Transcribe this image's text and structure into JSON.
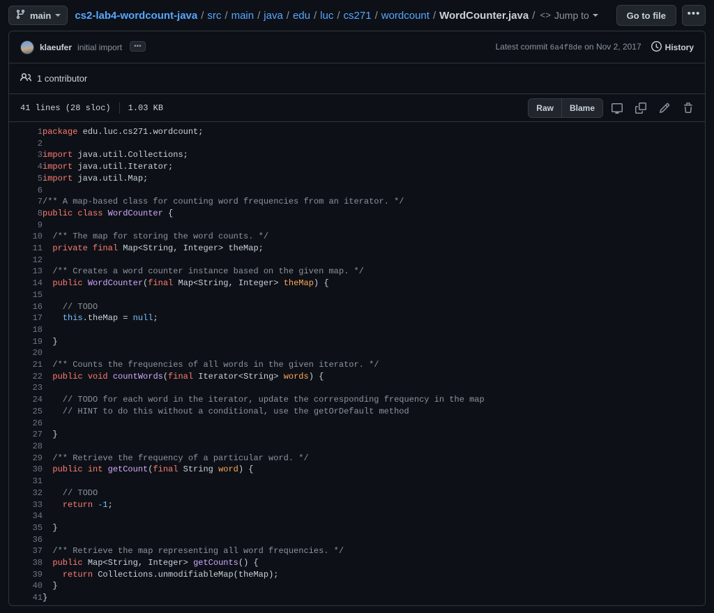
{
  "topbar": {
    "branch": {
      "label": "main",
      "icon": "git-branch-icon"
    },
    "breadcrumb": {
      "repo": "cs2-lab4-wordcount-java",
      "path": [
        "src",
        "main",
        "java",
        "edu",
        "luc",
        "cs271",
        "wordcount"
      ],
      "file": "WordCounter.java",
      "separator": "/"
    },
    "jump_to": {
      "label": "Jump to",
      "glyph": "<>"
    },
    "go_to_file": "Go to file",
    "kebab": "•••"
  },
  "commit": {
    "author": "klaeufer",
    "message": "initial import",
    "expand_label": "•••",
    "latest_commit_prefix": "Latest commit",
    "sha": "6a4f8de",
    "date_prefix": "on",
    "date": "Nov 2, 2017",
    "history_label": "History"
  },
  "contributors": {
    "count_label": "1 contributor",
    "icon": "people-icon"
  },
  "file_toolbar": {
    "lines": "41 lines (28 sloc)",
    "size": "1.03 KB",
    "raw": "Raw",
    "blame": "Blame",
    "icons": [
      "desktop-icon",
      "copy-icon",
      "pencil-icon",
      "trash-icon"
    ]
  },
  "code": {
    "lines": [
      {
        "n": 1,
        "tokens": [
          {
            "t": "package",
            "c": "k"
          },
          {
            "t": " edu.luc.cs271.wordcount;",
            "c": ""
          }
        ]
      },
      {
        "n": 2,
        "tokens": []
      },
      {
        "n": 3,
        "tokens": [
          {
            "t": "import",
            "c": "k"
          },
          {
            "t": " java.util.Collections;",
            "c": ""
          }
        ]
      },
      {
        "n": 4,
        "tokens": [
          {
            "t": "import",
            "c": "k"
          },
          {
            "t": " java.util.Iterator;",
            "c": ""
          }
        ]
      },
      {
        "n": 5,
        "tokens": [
          {
            "t": "import",
            "c": "k"
          },
          {
            "t": " java.util.Map;",
            "c": ""
          }
        ]
      },
      {
        "n": 6,
        "tokens": []
      },
      {
        "n": 7,
        "tokens": [
          {
            "t": "/** A map-based class for counting word frequencies from an iterator. */",
            "c": "c"
          }
        ]
      },
      {
        "n": 8,
        "tokens": [
          {
            "t": "public class",
            "c": "k"
          },
          {
            "t": " ",
            "c": ""
          },
          {
            "t": "WordCounter",
            "c": "f"
          },
          {
            "t": " {",
            "c": ""
          }
        ]
      },
      {
        "n": 9,
        "tokens": []
      },
      {
        "n": 10,
        "tokens": [
          {
            "t": "  /** The map for storing the word counts. */",
            "c": "c"
          }
        ]
      },
      {
        "n": 11,
        "tokens": [
          {
            "t": "  ",
            "c": ""
          },
          {
            "t": "private final",
            "c": "k"
          },
          {
            "t": " Map<String, Integer> theMap;",
            "c": ""
          }
        ]
      },
      {
        "n": 12,
        "tokens": []
      },
      {
        "n": 13,
        "tokens": [
          {
            "t": "  /** Creates a word counter instance based on the given map. */",
            "c": "c"
          }
        ]
      },
      {
        "n": 14,
        "tokens": [
          {
            "t": "  ",
            "c": ""
          },
          {
            "t": "public",
            "c": "k"
          },
          {
            "t": " ",
            "c": ""
          },
          {
            "t": "WordCounter",
            "c": "f"
          },
          {
            "t": "(",
            "c": ""
          },
          {
            "t": "final",
            "c": "k"
          },
          {
            "t": " Map<String, Integer> ",
            "c": ""
          },
          {
            "t": "theMap",
            "c": "p"
          },
          {
            "t": ") {",
            "c": ""
          }
        ]
      },
      {
        "n": 15,
        "tokens": []
      },
      {
        "n": 16,
        "tokens": [
          {
            "t": "    // TODO",
            "c": "c"
          }
        ]
      },
      {
        "n": 17,
        "tokens": [
          {
            "t": "    ",
            "c": ""
          },
          {
            "t": "this",
            "c": "n"
          },
          {
            "t": ".theMap = ",
            "c": ""
          },
          {
            "t": "null",
            "c": "n"
          },
          {
            "t": ";",
            "c": ""
          }
        ]
      },
      {
        "n": 18,
        "tokens": []
      },
      {
        "n": 19,
        "tokens": [
          {
            "t": "  }",
            "c": ""
          }
        ]
      },
      {
        "n": 20,
        "tokens": []
      },
      {
        "n": 21,
        "tokens": [
          {
            "t": "  /** Counts the frequencies of all words in the given iterator. */",
            "c": "c"
          }
        ]
      },
      {
        "n": 22,
        "tokens": [
          {
            "t": "  ",
            "c": ""
          },
          {
            "t": "public void",
            "c": "k"
          },
          {
            "t": " ",
            "c": ""
          },
          {
            "t": "countWords",
            "c": "f"
          },
          {
            "t": "(",
            "c": ""
          },
          {
            "t": "final",
            "c": "k"
          },
          {
            "t": " Iterator<String> ",
            "c": ""
          },
          {
            "t": "words",
            "c": "p"
          },
          {
            "t": ") {",
            "c": ""
          }
        ]
      },
      {
        "n": 23,
        "tokens": []
      },
      {
        "n": 24,
        "tokens": [
          {
            "t": "    // TODO for each word in the iterator, update the corresponding frequency in the map",
            "c": "c"
          }
        ]
      },
      {
        "n": 25,
        "tokens": [
          {
            "t": "    // HINT to do this without a conditional, use the getOrDefault method",
            "c": "c"
          }
        ]
      },
      {
        "n": 26,
        "tokens": []
      },
      {
        "n": 27,
        "tokens": [
          {
            "t": "  }",
            "c": ""
          }
        ]
      },
      {
        "n": 28,
        "tokens": []
      },
      {
        "n": 29,
        "tokens": [
          {
            "t": "  /** Retrieve the frequency of a particular word. */",
            "c": "c"
          }
        ]
      },
      {
        "n": 30,
        "tokens": [
          {
            "t": "  ",
            "c": ""
          },
          {
            "t": "public int",
            "c": "k"
          },
          {
            "t": " ",
            "c": ""
          },
          {
            "t": "getCount",
            "c": "f"
          },
          {
            "t": "(",
            "c": ""
          },
          {
            "t": "final",
            "c": "k"
          },
          {
            "t": " String ",
            "c": ""
          },
          {
            "t": "word",
            "c": "p"
          },
          {
            "t": ") {",
            "c": ""
          }
        ]
      },
      {
        "n": 31,
        "tokens": []
      },
      {
        "n": 32,
        "tokens": [
          {
            "t": "    // TODO",
            "c": "c"
          }
        ]
      },
      {
        "n": 33,
        "tokens": [
          {
            "t": "    ",
            "c": ""
          },
          {
            "t": "return",
            "c": "k"
          },
          {
            "t": " ",
            "c": ""
          },
          {
            "t": "-1",
            "c": "n"
          },
          {
            "t": ";",
            "c": ""
          }
        ]
      },
      {
        "n": 34,
        "tokens": []
      },
      {
        "n": 35,
        "tokens": [
          {
            "t": "  }",
            "c": ""
          }
        ]
      },
      {
        "n": 36,
        "tokens": []
      },
      {
        "n": 37,
        "tokens": [
          {
            "t": "  /** Retrieve the map representing all word frequencies. */",
            "c": "c"
          }
        ]
      },
      {
        "n": 38,
        "tokens": [
          {
            "t": "  ",
            "c": ""
          },
          {
            "t": "public",
            "c": "k"
          },
          {
            "t": " Map<String, Integer> ",
            "c": ""
          },
          {
            "t": "getCounts",
            "c": "f"
          },
          {
            "t": "() {",
            "c": ""
          }
        ]
      },
      {
        "n": 39,
        "tokens": [
          {
            "t": "    ",
            "c": ""
          },
          {
            "t": "return",
            "c": "k"
          },
          {
            "t": " Collections.unmodifiableMap(theMap);",
            "c": ""
          }
        ]
      },
      {
        "n": 40,
        "tokens": [
          {
            "t": "  }",
            "c": ""
          }
        ]
      },
      {
        "n": 41,
        "tokens": [
          {
            "t": "}",
            "c": ""
          }
        ]
      }
    ]
  }
}
